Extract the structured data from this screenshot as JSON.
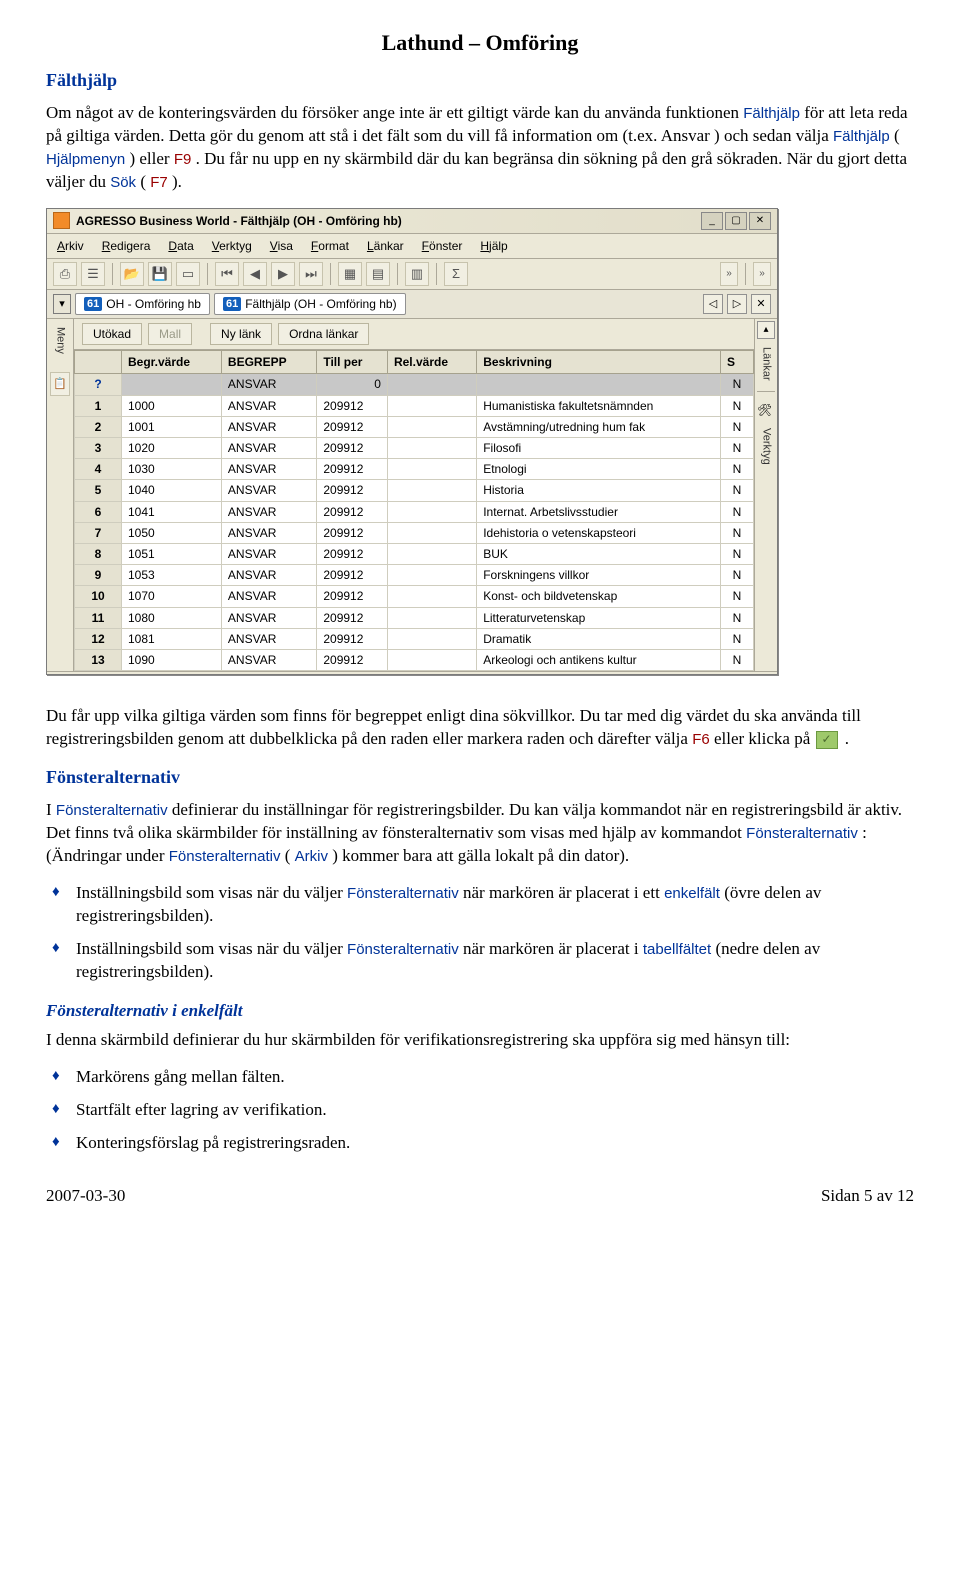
{
  "doc": {
    "title": "Lathund – Omföring",
    "section_falthjalp": "Fälthjälp",
    "para1a": "Om något av de konteringsvärden du försöker ange inte är ett giltigt värde kan du använda funktionen ",
    "para1b_sans": "Fälthjälp",
    "para1c": " för att leta reda på giltiga värden. Detta gör du genom att stå i det fält som du vill få information om (t.ex. Ansvar ) och sedan välja ",
    "para1d_sans": "Fälthjälp",
    "para1e": " (",
    "para1f_sans": "Hjälpmenyn",
    "para1g": ") eller ",
    "para1h_maroon": "F9",
    "para1i": ". Du får nu upp en ny skärmbild där du kan begränsa din sökning på den grå sökraden. När du gjort detta väljer du ",
    "para1j_sans": "Sök",
    "para1k": " (",
    "para1l_maroon": "F7",
    "para1m": ").",
    "para2a": "Du får upp vilka giltiga värden som finns för begreppet enligt dina sökvillkor. Du tar med dig värdet du ska använda till registreringsbilden genom att dubbelklicka på den raden eller markera raden och därefter välja ",
    "para2b_maroon": "F6",
    "para2c": " eller klicka på ",
    "para2d_after": ".",
    "section_fonster": "Fönsteralternativ",
    "para3a": "I ",
    "para3b_sans": "Fönsteralternativ",
    "para3c": " definierar du inställningar för registreringsbilder. Du kan välja kommandot när en registreringsbild är aktiv. Det finns två olika skärmbilder för inställning av fönsteralternativ som visas med hjälp av kommandot ",
    "para3d_sans": "Fönsteralternativ",
    "para3e": ": (Ändringar under ",
    "para3f_sans": "Fönsteralternativ",
    "para3g": " (",
    "para3h_sans": "Arkiv",
    "para3i": ") kommer bara att gälla lokalt på din dator).",
    "bullet1a": "Inställningsbild som visas när du väljer ",
    "bullet1b_sans": "Fönsteralternativ",
    "bullet1c": " när markören är placerat i ett ",
    "bullet1d_sans": "enkelfält",
    "bullet1e": " (övre delen av registreringsbilden).",
    "bullet2a": "Inställningsbild som visas när du väljer ",
    "bullet2b_sans": "Fönsteralternativ",
    "bullet2c": " när markören är placerat i ",
    "bullet2d_sans": "tabellfältet",
    "bullet2e": " (nedre delen av registreringsbilden).",
    "sub_enkelfalt": "Fönsteralternativ i enkelfält",
    "para4": "I denna skärmbild definierar du hur skärmbilden för verifikationsregistrering ska uppföra sig med hänsyn till:",
    "bullet3": "Markörens gång mellan fälten.",
    "bullet4": "Startfält efter lagring av verifikation.",
    "bullet5": "Konteringsförslag på registreringsraden.",
    "footer_date": "2007-03-30",
    "footer_page": "Sidan 5 av 12"
  },
  "app": {
    "title": "AGRESSO Business World - Fälthjälp (OH - Omföring hb)",
    "menus": [
      "Arkiv",
      "Redigera",
      "Data",
      "Verktyg",
      "Visa",
      "Format",
      "Länkar",
      "Fönster",
      "Hjälp"
    ],
    "tab1": "OH - Omföring hb",
    "tab2": "Fälthjälp (OH - Omföring hb)",
    "left_label": "Meny",
    "sub_buttons": {
      "utokad": "Utökad",
      "mall": "Mall",
      "nylank": "Ny länk",
      "ordna": "Ordna länkar"
    },
    "columns": [
      "Begr.värde",
      "BEGREPP",
      "Till per",
      "Rel.värde",
      "Beskrivning",
      "S"
    ],
    "search_row": [
      "",
      "ANSVAR",
      "0",
      "",
      "",
      "N"
    ],
    "rows": [
      {
        "n": "1",
        "begr": "1000",
        "beg": "ANSVAR",
        "till": "209912",
        "rel": "",
        "besk": "Humanistiska fakultetsnämnden",
        "s": "N"
      },
      {
        "n": "2",
        "begr": "1001",
        "beg": "ANSVAR",
        "till": "209912",
        "rel": "",
        "besk": "Avstämning/utredning hum fak",
        "s": "N"
      },
      {
        "n": "3",
        "begr": "1020",
        "beg": "ANSVAR",
        "till": "209912",
        "rel": "",
        "besk": "Filosofi",
        "s": "N"
      },
      {
        "n": "4",
        "begr": "1030",
        "beg": "ANSVAR",
        "till": "209912",
        "rel": "",
        "besk": "Etnologi",
        "s": "N"
      },
      {
        "n": "5",
        "begr": "1040",
        "beg": "ANSVAR",
        "till": "209912",
        "rel": "",
        "besk": "Historia",
        "s": "N"
      },
      {
        "n": "6",
        "begr": "1041",
        "beg": "ANSVAR",
        "till": "209912",
        "rel": "",
        "besk": "Internat. Arbetslivsstudier",
        "s": "N"
      },
      {
        "n": "7",
        "begr": "1050",
        "beg": "ANSVAR",
        "till": "209912",
        "rel": "",
        "besk": "Idehistoria o vetenskapsteori",
        "s": "N"
      },
      {
        "n": "8",
        "begr": "1051",
        "beg": "ANSVAR",
        "till": "209912",
        "rel": "",
        "besk": "BUK",
        "s": "N"
      },
      {
        "n": "9",
        "begr": "1053",
        "beg": "ANSVAR",
        "till": "209912",
        "rel": "",
        "besk": "Forskningens villkor",
        "s": "N"
      },
      {
        "n": "10",
        "begr": "1070",
        "beg": "ANSVAR",
        "till": "209912",
        "rel": "",
        "besk": "Konst- och bildvetenskap",
        "s": "N"
      },
      {
        "n": "11",
        "begr": "1080",
        "beg": "ANSVAR",
        "till": "209912",
        "rel": "",
        "besk": "Litteraturvetenskap",
        "s": "N"
      },
      {
        "n": "12",
        "begr": "1081",
        "beg": "ANSVAR",
        "till": "209912",
        "rel": "",
        "besk": "Dramatik",
        "s": "N"
      },
      {
        "n": "13",
        "begr": "1090",
        "beg": "ANSVAR",
        "till": "209912",
        "rel": "",
        "besk": "Arkeologi och antikens kultur",
        "s": "N"
      }
    ],
    "right_labels": [
      "Länkar",
      "Verktyg"
    ],
    "tabnum": "61"
  }
}
